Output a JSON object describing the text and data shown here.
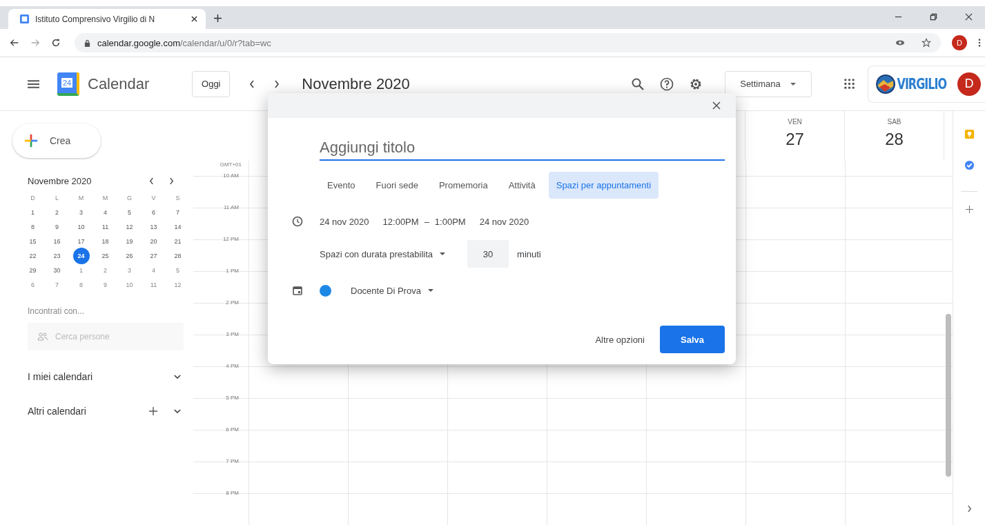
{
  "browser": {
    "tab_title": "Istituto Comprensivo Virgilio di N",
    "url_host": "calendar.google.com",
    "url_path": "/calendar/u/0/r?tab=wc",
    "profile_initial": "D"
  },
  "header": {
    "logo_day": "24",
    "app_name": "Calendar",
    "today_button": "Oggi",
    "period": "Novembre 2020",
    "view_select": "Settimana",
    "brand_logo_text": "VIRGILIO",
    "avatar_initial": "D"
  },
  "sidebar": {
    "create_button": "Crea",
    "mini_calendar": {
      "title": "Novembre 2020",
      "weekdays": [
        "D",
        "L",
        "M",
        "M",
        "G",
        "V",
        "S"
      ],
      "weeks": [
        [
          {
            "day": "1",
            "selected": false,
            "muted": false
          },
          {
            "day": "2",
            "selected": false,
            "muted": false
          },
          {
            "day": "3",
            "selected": false,
            "muted": false
          },
          {
            "day": "4",
            "selected": false,
            "muted": false
          },
          {
            "day": "5",
            "selected": false,
            "muted": false
          },
          {
            "day": "6",
            "selected": false,
            "muted": false
          },
          {
            "day": "7",
            "selected": false,
            "muted": false
          }
        ],
        [
          {
            "day": "8",
            "selected": false,
            "muted": false
          },
          {
            "day": "9",
            "selected": false,
            "muted": false
          },
          {
            "day": "10",
            "selected": false,
            "muted": false
          },
          {
            "day": "11",
            "selected": false,
            "muted": false
          },
          {
            "day": "12",
            "selected": false,
            "muted": false
          },
          {
            "day": "13",
            "selected": false,
            "muted": false
          },
          {
            "day": "14",
            "selected": false,
            "muted": false
          }
        ],
        [
          {
            "day": "15",
            "selected": false,
            "muted": false
          },
          {
            "day": "16",
            "selected": false,
            "muted": false
          },
          {
            "day": "17",
            "selected": false,
            "muted": false
          },
          {
            "day": "18",
            "selected": false,
            "muted": false
          },
          {
            "day": "19",
            "selected": false,
            "muted": false
          },
          {
            "day": "20",
            "selected": false,
            "muted": false
          },
          {
            "day": "21",
            "selected": false,
            "muted": false
          }
        ],
        [
          {
            "day": "22",
            "selected": false,
            "muted": false
          },
          {
            "day": "23",
            "selected": false,
            "muted": false
          },
          {
            "day": "24",
            "selected": true,
            "muted": false
          },
          {
            "day": "25",
            "selected": false,
            "muted": false
          },
          {
            "day": "26",
            "selected": false,
            "muted": false
          },
          {
            "day": "27",
            "selected": false,
            "muted": false
          },
          {
            "day": "28",
            "selected": false,
            "muted": false
          }
        ],
        [
          {
            "day": "29",
            "selected": false,
            "muted": false
          },
          {
            "day": "30",
            "selected": false,
            "muted": false
          },
          {
            "day": "1",
            "selected": false,
            "muted": true
          },
          {
            "day": "2",
            "selected": false,
            "muted": true
          },
          {
            "day": "3",
            "selected": false,
            "muted": true
          },
          {
            "day": "4",
            "selected": false,
            "muted": true
          },
          {
            "day": "5",
            "selected": false,
            "muted": true
          }
        ],
        [
          {
            "day": "6",
            "selected": false,
            "muted": true
          },
          {
            "day": "7",
            "selected": false,
            "muted": true
          },
          {
            "day": "8",
            "selected": false,
            "muted": true
          },
          {
            "day": "9",
            "selected": false,
            "muted": true
          },
          {
            "day": "10",
            "selected": false,
            "muted": true
          },
          {
            "day": "11",
            "selected": false,
            "muted": true
          },
          {
            "day": "12",
            "selected": false,
            "muted": true
          }
        ]
      ]
    },
    "meet_heading": "Incontrati con...",
    "people_search": {
      "placeholder": "Cerca persone"
    },
    "sections": [
      {
        "label": "I miei calendari",
        "add": false
      },
      {
        "label": "Altri calendari",
        "add": true
      }
    ]
  },
  "time_grid": {
    "timezone": "GMT+01",
    "hours": [
      "10 AM",
      "11 AM",
      "12 PM",
      "1 PM",
      "2 PM",
      "3 PM",
      "4 PM",
      "5 PM",
      "6 PM",
      "7 PM",
      "8 PM"
    ],
    "visible_days": [
      {
        "weekday": "VEN",
        "date": "27"
      },
      {
        "weekday": "SAB",
        "date": "28"
      }
    ]
  },
  "dialog": {
    "title_placeholder": "Aggiungi titolo",
    "types": [
      {
        "label": "Evento",
        "selected": false
      },
      {
        "label": "Fuori sede",
        "selected": false
      },
      {
        "label": "Promemoria",
        "selected": false
      },
      {
        "label": "Attività",
        "selected": false
      },
      {
        "label": "Spazi per appuntamenti",
        "selected": true
      }
    ],
    "start_date": "24 nov 2020",
    "start_time": "12:00PM",
    "separator": "–",
    "end_time": "1:00PM",
    "end_date": "24 nov 2020",
    "slot_mode": "Spazi con durata prestabilita",
    "slot_minutes": "30",
    "minutes_unit": "minuti",
    "calendar": {
      "name": "Docente Di Prova",
      "color": "#1e88e5"
    },
    "more_options": "Altre opzioni",
    "save_button": "Salva"
  }
}
